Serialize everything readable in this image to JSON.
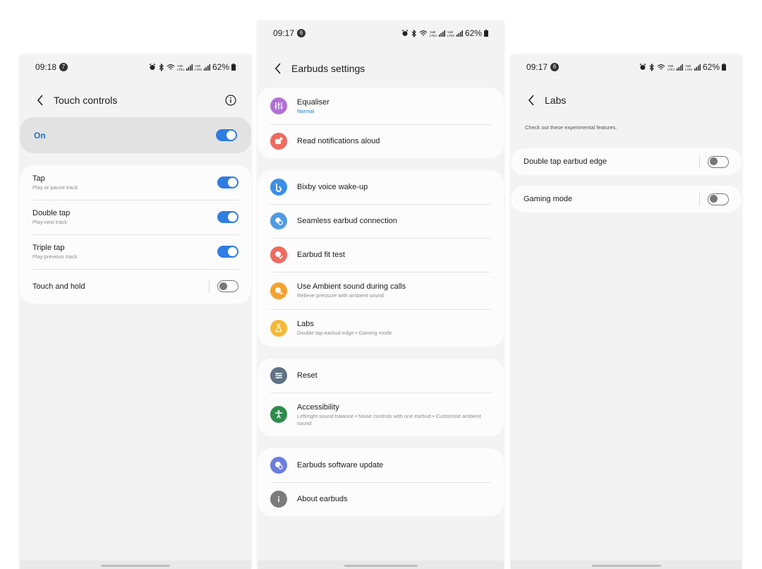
{
  "touch": {
    "status": {
      "time": "09:18",
      "badge": "7",
      "battery": "62%"
    },
    "title": "Touch controls",
    "master": {
      "label": "On",
      "on": true
    },
    "items": [
      {
        "title": "Tap",
        "subtitle": "Play or pause track",
        "on": true
      },
      {
        "title": "Double tap",
        "subtitle": "Play next track",
        "on": true
      },
      {
        "title": "Triple tap",
        "subtitle": "Play previous track",
        "on": true
      },
      {
        "title": "Touch and hold",
        "subtitle": "",
        "on": false
      }
    ]
  },
  "settings": {
    "status": {
      "time": "09:17",
      "badge": "6",
      "battery": "62%"
    },
    "title": "Earbuds settings",
    "groups": [
      [
        {
          "title": "Equaliser",
          "subtitle": "Normal",
          "icon": "equaliser-icon",
          "color": "#b270d6"
        },
        {
          "title": "Read notifications aloud",
          "subtitle": "",
          "icon": "notifications-icon",
          "color": "#ef6b5f"
        }
      ],
      [
        {
          "title": "Bixby voice wake-up",
          "subtitle": "",
          "icon": "bixby-icon",
          "color": "#3d8ee8"
        },
        {
          "title": "Seamless earbud connection",
          "subtitle": "",
          "icon": "seamless-connection-icon",
          "color": "#4f9be3"
        },
        {
          "title": "Earbud fit test",
          "subtitle": "",
          "icon": "fit-test-icon",
          "color": "#ef6b5f"
        },
        {
          "title": "Use Ambient sound during calls",
          "subtitle": "Relieve pressure with ambient sound",
          "icon": "ambient-sound-icon",
          "color": "#f5a22e"
        },
        {
          "title": "Labs",
          "subtitle": "Double tap earbud edge  •  Gaming mode",
          "icon": "labs-icon",
          "color": "#f5b93a"
        }
      ],
      [
        {
          "title": "Reset",
          "subtitle": "",
          "icon": "reset-icon",
          "color": "#5f7183"
        },
        {
          "title": "Accessibility",
          "subtitle": "Left/right sound balance  •  Noise controls with one earbud  •  Customise ambient sound",
          "icon": "accessibility-icon",
          "color": "#2e8b4c"
        }
      ],
      [
        {
          "title": "Earbuds software update",
          "subtitle": "",
          "icon": "software-update-icon",
          "color": "#6d7ddf"
        },
        {
          "title": "About earbuds",
          "subtitle": "",
          "icon": "about-icon",
          "color": "#7b7b7b"
        }
      ]
    ]
  },
  "labs": {
    "status": {
      "time": "09:17",
      "badge": "6",
      "battery": "62%"
    },
    "title": "Labs",
    "description": "Check out these experimental features.",
    "items": [
      {
        "title": "Double tap earbud edge",
        "on": false
      },
      {
        "title": "Gaming mode",
        "on": false
      }
    ]
  }
}
